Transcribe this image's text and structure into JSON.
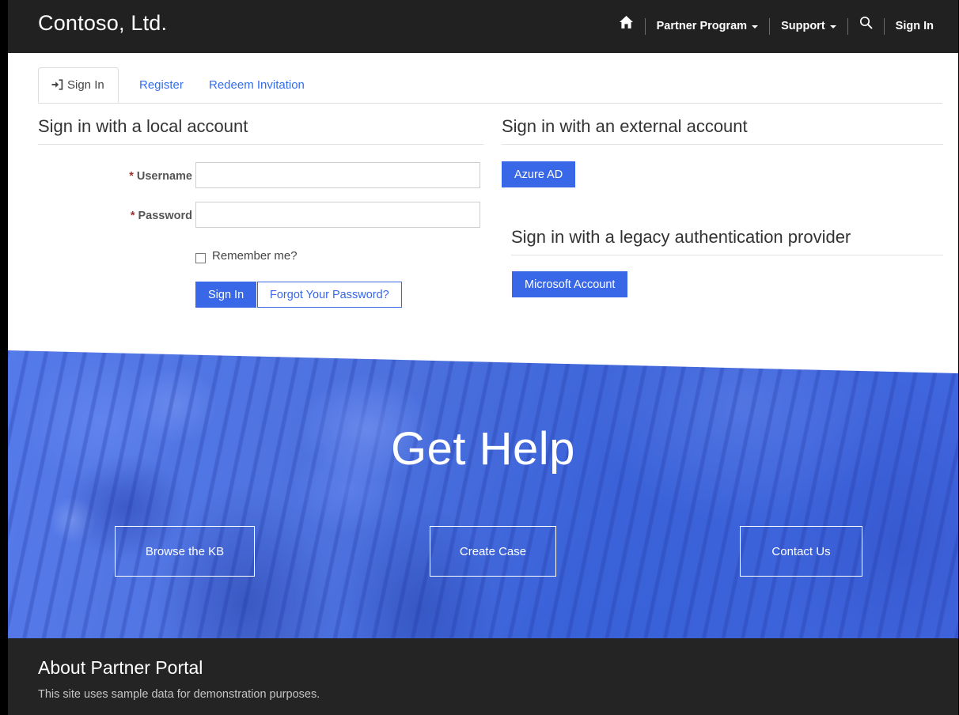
{
  "navbar": {
    "brand": "Contoso, Ltd.",
    "home_icon": "home-icon",
    "search_icon": "search-icon",
    "items": [
      {
        "label": "Partner Program",
        "has_caret": true
      },
      {
        "label": "Support",
        "has_caret": true
      },
      {
        "label": "Sign In",
        "has_caret": false
      }
    ]
  },
  "tabs": [
    {
      "label": "Sign In",
      "icon": "sign-in-icon",
      "active": true
    },
    {
      "label": "Register",
      "active": false
    },
    {
      "label": "Redeem Invitation",
      "active": false
    }
  ],
  "local_account": {
    "heading": "Sign in with a local account",
    "username": {
      "required_marker": "*",
      "label": "Username",
      "value": "",
      "placeholder": ""
    },
    "password": {
      "required_marker": "*",
      "label": "Password",
      "value": "",
      "placeholder": ""
    },
    "remember_label": "Remember me?",
    "remember_checked": false,
    "submit_label": "Sign In",
    "forgot_label": "Forgot Your Password?"
  },
  "external_account": {
    "heading": "Sign in with an external account",
    "providers": [
      {
        "label": "Azure AD"
      }
    ]
  },
  "legacy_account": {
    "heading": "Sign in with a legacy authentication provider",
    "providers": [
      {
        "label": "Microsoft Account"
      }
    ]
  },
  "hero": {
    "title": "Get Help",
    "buttons": [
      {
        "label": "Browse the KB"
      },
      {
        "label": "Create Case"
      },
      {
        "label": "Contact Us"
      }
    ]
  },
  "footer": {
    "title": "About Partner Portal",
    "text": "This site uses sample data for demonstration purposes."
  },
  "colors": {
    "navbar_bg": "#212121",
    "footer_bg": "#242424",
    "accent_blue": "#3867e8",
    "link_blue": "#336dec",
    "hero_blue": "#3c64da",
    "required_red": "#9b3232"
  }
}
